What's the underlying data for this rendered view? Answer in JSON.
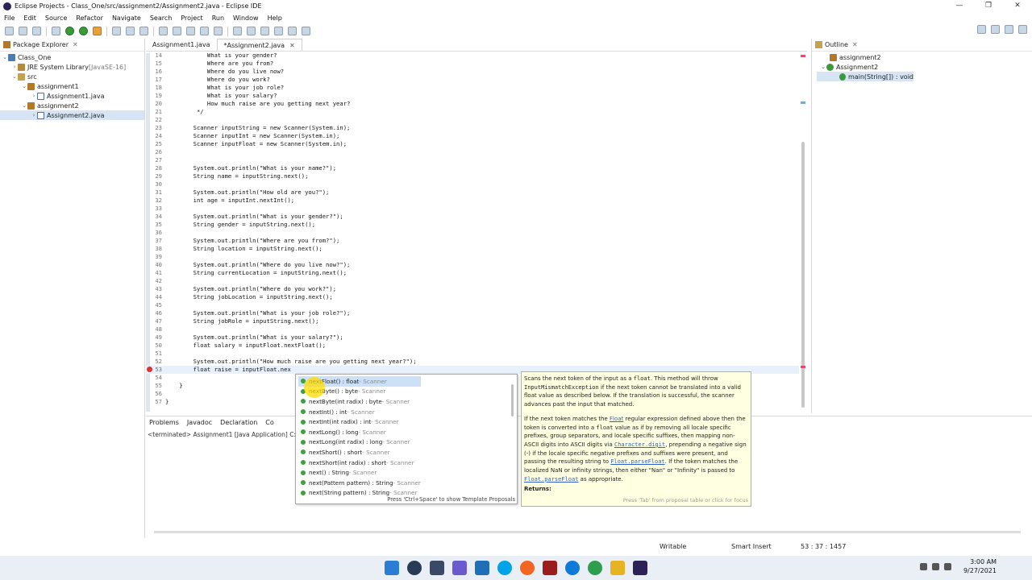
{
  "window": {
    "title": "Eclipse Projects - Class_One/src/assignment2/Assignment2.java - Eclipse IDE",
    "controls": [
      "—",
      "❐",
      "✕"
    ]
  },
  "menu": [
    "File",
    "Edit",
    "Source",
    "Refactor",
    "Navigate",
    "Search",
    "Project",
    "Run",
    "Window",
    "Help"
  ],
  "package_explorer": {
    "title": "Package Explorer",
    "items": [
      {
        "label": "Class_One",
        "suffix": ""
      },
      {
        "label": "JRE System Library",
        "suffix": " [JavaSE-16]"
      },
      {
        "label": "src",
        "suffix": ""
      },
      {
        "label": "assignment1",
        "suffix": ""
      },
      {
        "label": "Assignment1.java",
        "suffix": ""
      },
      {
        "label": "assignment2",
        "suffix": ""
      },
      {
        "label": "Assignment2.java",
        "suffix": ""
      }
    ]
  },
  "editor": {
    "tabs": [
      "Assignment1.java",
      "*Assignment2.java"
    ],
    "lines": [
      {
        "n": "14",
        "t": "            What is your gender?"
      },
      {
        "n": "15",
        "t": "            Where are you from?"
      },
      {
        "n": "16",
        "t": "            Where do you live now?"
      },
      {
        "n": "17",
        "t": "            Where do you work?"
      },
      {
        "n": "18",
        "t": "            What is your job role?"
      },
      {
        "n": "19",
        "t": "            What is your salary?"
      },
      {
        "n": "20",
        "t": "            How much raise are you getting next year?"
      },
      {
        "n": "21",
        "t": "         */"
      },
      {
        "n": "22",
        "t": ""
      },
      {
        "n": "23",
        "t": "        Scanner inputString = new Scanner(System.in);"
      },
      {
        "n": "24",
        "t": "        Scanner inputInt = new Scanner(System.in);"
      },
      {
        "n": "25",
        "t": "        Scanner inputFloat = new Scanner(System.in);"
      },
      {
        "n": "26",
        "t": ""
      },
      {
        "n": "27",
        "t": ""
      },
      {
        "n": "28",
        "t": "        System.out.println(\"What is your name?\");"
      },
      {
        "n": "29",
        "t": "        String name = inputString.next();"
      },
      {
        "n": "30",
        "t": ""
      },
      {
        "n": "31",
        "t": "        System.out.println(\"How old are you?\");"
      },
      {
        "n": "32",
        "t": "        int age = inputInt.nextInt();"
      },
      {
        "n": "33",
        "t": ""
      },
      {
        "n": "34",
        "t": "        System.out.println(\"What is your gender?\");"
      },
      {
        "n": "35",
        "t": "        String gender = inputString.next();"
      },
      {
        "n": "36",
        "t": ""
      },
      {
        "n": "37",
        "t": "        System.out.println(\"Where are you from?\");"
      },
      {
        "n": "38",
        "t": "        String location = inputString.next();"
      },
      {
        "n": "39",
        "t": ""
      },
      {
        "n": "40",
        "t": "        System.out.println(\"Where do you live now?\");"
      },
      {
        "n": "41",
        "t": "        String currentLocation = inputString.next();"
      },
      {
        "n": "42",
        "t": ""
      },
      {
        "n": "43",
        "t": "        System.out.println(\"Where do you work?\");"
      },
      {
        "n": "44",
        "t": "        String jobLocation = inputString.next();"
      },
      {
        "n": "45",
        "t": ""
      },
      {
        "n": "46",
        "t": "        System.out.println(\"What is your job role?\");"
      },
      {
        "n": "47",
        "t": "        String jobRole = inputString.next();"
      },
      {
        "n": "48",
        "t": ""
      },
      {
        "n": "49",
        "t": "        System.out.println(\"What is your salary?\");"
      },
      {
        "n": "50",
        "t": "        float salary = inputFloat.nextFloat();"
      },
      {
        "n": "51",
        "t": ""
      },
      {
        "n": "52",
        "t": "        System.out.println(\"How much raise are you getting next year?\");"
      },
      {
        "n": "53",
        "t": "        float raise = inputFloat.nex"
      },
      {
        "n": "54",
        "t": ""
      },
      {
        "n": "55",
        "t": "    }"
      },
      {
        "n": "56",
        "t": ""
      },
      {
        "n": "57",
        "t": "}"
      }
    ]
  },
  "outline": {
    "title": "Outline",
    "items": [
      "assignment2",
      "Assignment2",
      "main(String[]) : void"
    ]
  },
  "bottom_panel": {
    "tabs": [
      "Problems",
      "Javadoc",
      "Declaration",
      "Co"
    ],
    "console": "<terminated> Assignment1 [Java Application] C:\\ec"
  },
  "content_assist": {
    "proposals": [
      {
        "name": "nextFloat() : float",
        "type": " - Scanner"
      },
      {
        "name": "nextByte() : byte",
        "type": " - Scanner"
      },
      {
        "name": "nextByte(int radix) : byte",
        "type": " - Scanner"
      },
      {
        "name": "nextInt() : int",
        "type": " - Scanner"
      },
      {
        "name": "nextInt(int radix) : int",
        "type": " - Scanner"
      },
      {
        "name": "nextLong() : long",
        "type": " - Scanner"
      },
      {
        "name": "nextLong(int radix) : long",
        "type": " - Scanner"
      },
      {
        "name": "nextShort() : short",
        "type": " - Scanner"
      },
      {
        "name": "nextShort(int radix) : short",
        "type": " - Scanner"
      },
      {
        "name": "next() : String",
        "type": " - Scanner"
      },
      {
        "name": "next(Pattern pattern) : String",
        "type": " - Scanner"
      },
      {
        "name": "next(String pattern) : String",
        "type": " - Scanner"
      }
    ],
    "hint": "Press 'Ctrl+Space' to show Template Proposals"
  },
  "javadoc": {
    "p1a": "Scans the next token of the input as a ",
    "p1b": "float",
    "p1c": ". This method will throw ",
    "p1d": "InputMismatchException",
    "p1e": " if the next token cannot be translated into a valid float value as described below. If the translation is successful, the scanner advances past the input that matched.",
    "p2a": "If the next token matches the ",
    "p2b": "Float",
    "p2c": " regular expression defined above then the token is converted into a ",
    "p2d": "float",
    "p2e": " value as if by removing all locale specific prefixes, group separators, and locale specific suffixes, then mapping non-ASCII digits into ASCII digits via ",
    "p2f": "Character.digit",
    "p2g": ", prepending a negative sign (-) if the locale specific negative prefixes and suffixes were present, and passing the resulting string to ",
    "p2h": "Float.parseFloat",
    "p2i": ". If the token matches the localized NaN or infinity strings, then either \"Nan\" or \"Infinity\" is passed to ",
    "p2j": "Float.parseFloat",
    "p2k": " as appropriate.",
    "returns": "Returns:",
    "hint": "Press 'Tab' from proposal table or click for focus"
  },
  "status": {
    "writable": "Writable",
    "insert": "Smart Insert",
    "position": "53 : 37 : 1457"
  },
  "clock": {
    "time": "3:00 AM",
    "date": "9/27/2021"
  }
}
